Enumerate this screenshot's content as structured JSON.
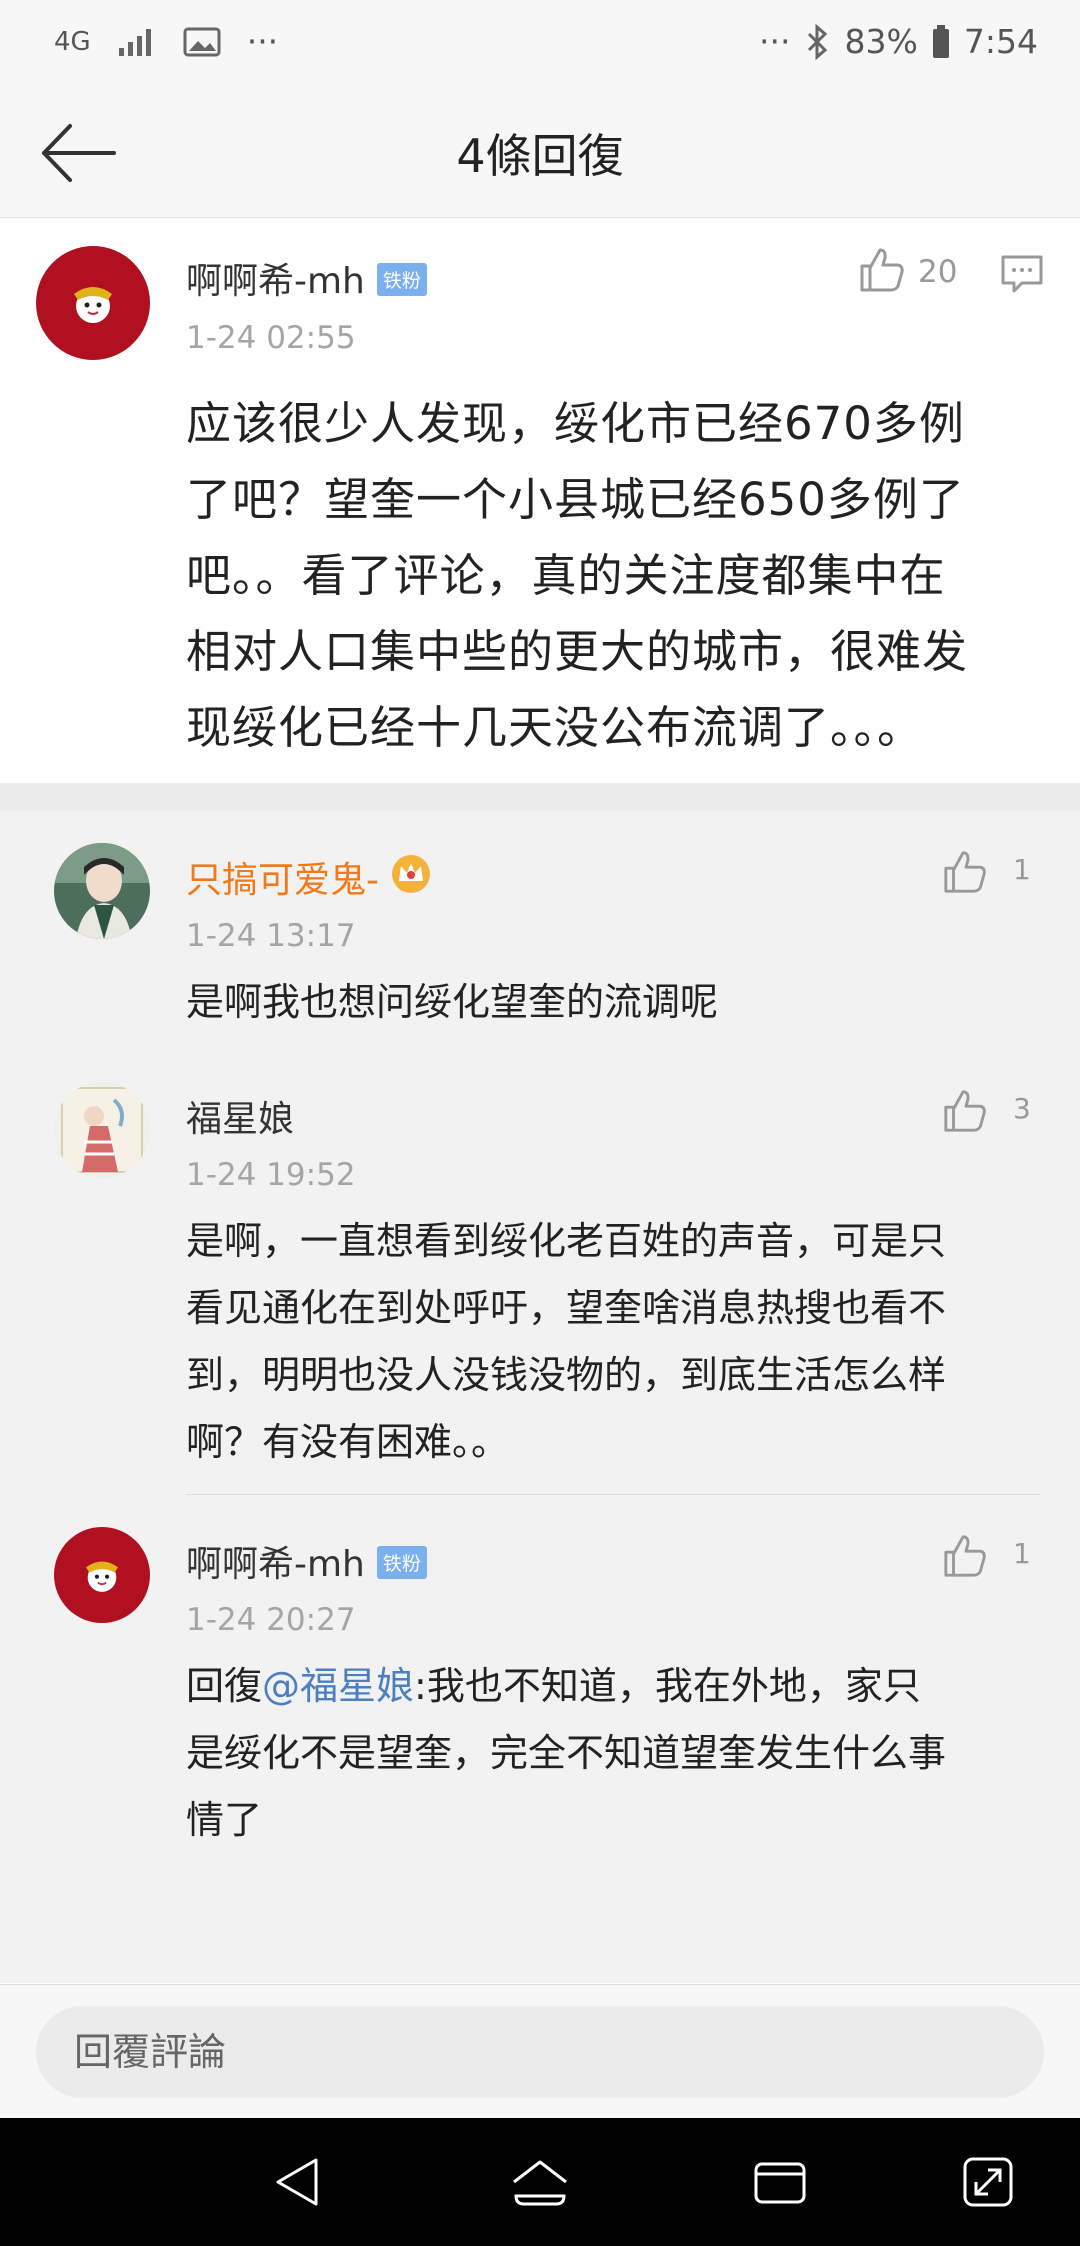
{
  "status_bar": {
    "network": "4G",
    "dots": "···",
    "dots_right": "···",
    "battery": "83%",
    "time": "7:54"
  },
  "header": {
    "title": "4條回復"
  },
  "main_comment": {
    "username": "啊啊希-mh",
    "badge": "铁粉",
    "time": "1-24 02:55",
    "likes": "20",
    "lines": [
      "应该很少人发现，绥化市已经670多例",
      "了吧？望奎一个小县城已经650多例了",
      "吧。。看了评论，真的关注度都集中在",
      "相对人口集中些的更大的城市，很难发",
      "现绥化已经十几天没公布流调了。。。"
    ]
  },
  "replies": [
    {
      "username": "只搞可爱鬼-",
      "time": "1-24 13:17",
      "likes": "1",
      "lines": [
        "是啊我也想问绥化望奎的流调呢"
      ]
    },
    {
      "username": "福星娘",
      "time": "1-24 19:52",
      "likes": "3",
      "lines": [
        "是啊，一直想看到绥化老百姓的声音，可是只",
        "看见通化在到处呼吁，望奎啥消息热搜也看不",
        "到，明明也没人没钱没物的，到底生活怎么样",
        "啊？有没有困难。。"
      ]
    },
    {
      "username": "啊啊希-mh",
      "badge": "铁粉",
      "time": "1-24 20:27",
      "likes": "1",
      "reply_prefix": "回復",
      "mention": "@福星娘",
      "first_line_rest": ":我也不知道，我在外地，家只",
      "lines": [
        "是绥化不是望奎，完全不知道望奎发生什么事",
        "情了"
      ]
    }
  ],
  "input": {
    "placeholder": "回覆評論"
  },
  "colors": {
    "vip_name": "#f07a1a",
    "mention": "#4c7fbf",
    "badge": "#7bb0ee",
    "avatar_red": "#b01020"
  }
}
